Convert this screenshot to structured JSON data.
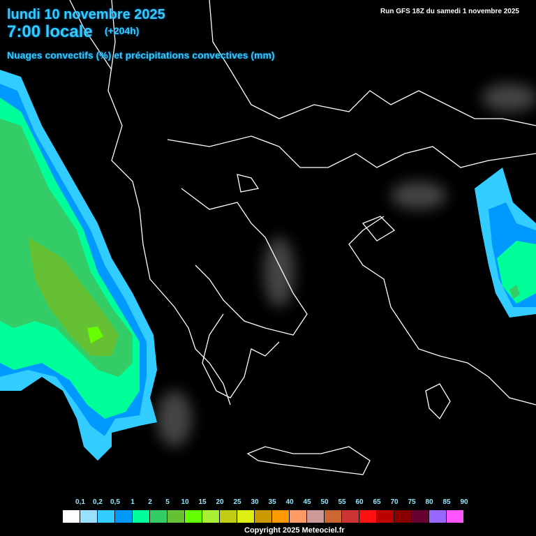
{
  "header": {
    "date": "lundi 10 novembre 2025",
    "hour": "7:00 locale",
    "lead_time": "(+204h)",
    "parameter": "Nuages convectifs (%) et précipitations convectives (mm)",
    "run": "Run GFS 18Z du samedi 1 novembre 2025"
  },
  "legend": {
    "labels": [
      "0,1",
      "0,2",
      "0,5",
      "1",
      "2",
      "5",
      "10",
      "15",
      "20",
      "25",
      "30",
      "35",
      "40",
      "45",
      "50",
      "55",
      "60",
      "65",
      "70",
      "75",
      "80",
      "85",
      "90"
    ],
    "colors": [
      "#ffffff",
      "#99e0ff",
      "#33ccff",
      "#0099ff",
      "#00ff99",
      "#33cc66",
      "#66c033",
      "#66ff00",
      "#a8ee33",
      "#bfcc11",
      "#ddee11",
      "#cc9900",
      "#ff9900",
      "#ff9966",
      "#cc9999",
      "#cc6633",
      "#cc3333",
      "#ff1111",
      "#bb0000",
      "#880000",
      "#660033",
      "#9966ff",
      "#ff55ff"
    ]
  },
  "footer": {
    "copyright": "Copyright 2025 Meteociel.fr"
  }
}
